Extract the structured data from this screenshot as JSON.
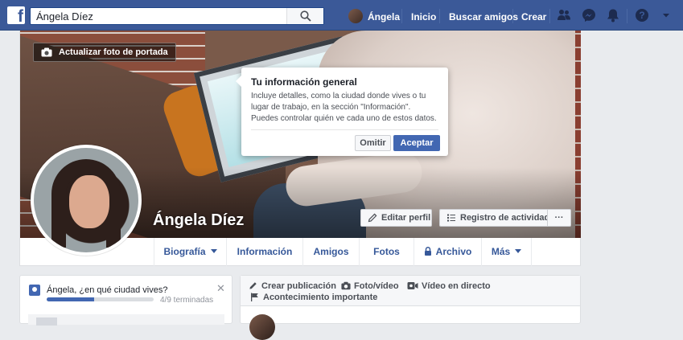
{
  "topbar": {
    "logo": "f",
    "search_value": "Ángela Díez",
    "user_name": "Ángela",
    "nav": [
      "Inicio",
      "Buscar amigos",
      "Crear"
    ],
    "icons": [
      "friend-requests-icon",
      "messenger-icon",
      "notifications-bell-icon",
      "help-icon",
      "caret-down-icon"
    ]
  },
  "cover": {
    "update_label": "Actualizar foto de portada",
    "profile_name": "Ángela Díez",
    "edit_profile_label": "Editar perfil",
    "activity_log_label": "Registro de actividad",
    "more_label": "···"
  },
  "popover": {
    "title": "Tu información general",
    "body": "Incluye detalles, como la ciudad donde vives o tu lugar de trabajo, en la sección \"Información\". Puedes controlar quién ve cada uno de estos datos.",
    "skip": "Omitir",
    "accept": "Aceptar"
  },
  "tabs": {
    "biografia": "Biografía",
    "informacion": "Información",
    "amigos": "Amigos",
    "fotos": "Fotos",
    "archivo": "Archivo",
    "mas": "Más"
  },
  "city_widget": {
    "question": "Ángela, ¿en qué ciudad vives?",
    "progress_label": "4/9 terminadas",
    "progress_fraction": 0.444
  },
  "composer": {
    "create_post": "Crear publicación",
    "photo_video": "Foto/vídeo",
    "live_video": "Vídeo en directo",
    "life_event": "Acontecimiento importante"
  },
  "colors": {
    "brand_blue": "#3b5998",
    "button_blue": "#4267b2",
    "link_blue": "#365899",
    "page_bg": "#e9ebee"
  }
}
